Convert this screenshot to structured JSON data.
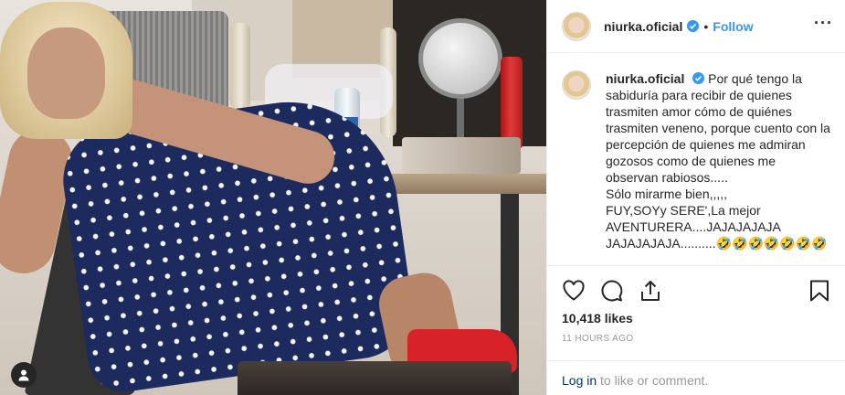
{
  "post": {
    "username": "niurka.oficial",
    "follow_label": "Follow",
    "separator": "•",
    "more_label": "···",
    "caption_first": "Por qué tengo la sabiduría para recibir de quienes trasmiten amor cómo de quiénes trasmiten veneno, porque cuento con la percepción de quienes me admiran gozosos como de quienes me observan rabiosos.....",
    "caption_lines": [
      "Sólo mirarme bien,,,,,",
      "FUY,SOYy SERE',La mejor",
      "AVENTURERA....JAJAJAJAJA",
      "JAJAJAJAJA..........🤣🤣🤣🤣🤣🤣🤣"
    ],
    "likes": "10,418 likes",
    "time_ago": "11 HOURS AGO",
    "login_link": "Log in",
    "login_rest": " to like or comment."
  },
  "icons": {
    "verified": "verified-badge-icon",
    "heart": "heart-icon",
    "comment": "comment-icon",
    "share": "share-icon",
    "bookmark": "bookmark-icon",
    "user": "user-icon"
  },
  "colors": {
    "accent": "#3897f0",
    "link_dark": "#003569",
    "text": "#262626",
    "muted": "#999999",
    "border": "#efefef"
  }
}
